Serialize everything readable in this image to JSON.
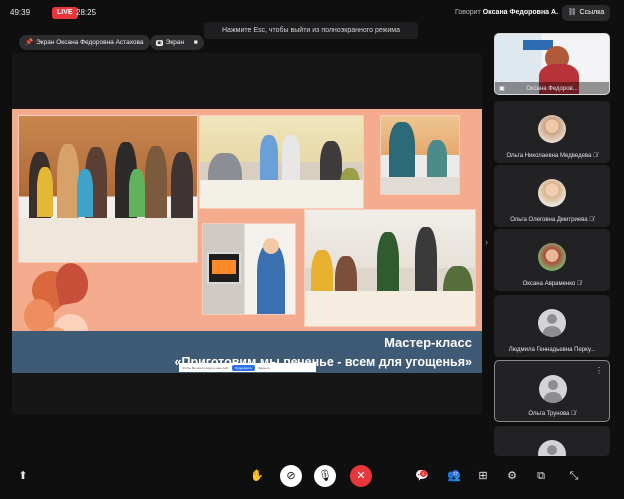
{
  "topbar": {
    "time": "49:39",
    "live_label": "LIVE",
    "elapsed": "28:25",
    "speaking_prefix": "Говорит",
    "speaking_name": "Оксана Федоровна А.",
    "link_label": "Ссылка"
  },
  "esc_hint": "Нажмите Esc, чтобы выйти из полноэкранного режима",
  "screen_share": {
    "presenter_pill": "Экран Оксана Федоровна Астахова",
    "screen_pill": "Экран"
  },
  "slide": {
    "title": "Мастер-класс",
    "subtitle": "«Приготовим мы печенье - всем для угощенья»"
  },
  "toast": {
    "text": "Чтобы Вы могли видеть наш сайт",
    "button_primary": "Продолжить",
    "button_secondary": "Закрыть"
  },
  "participants": [
    {
      "name": "Оксана Федоров...",
      "type": "video"
    },
    {
      "name": "Ольга Николаевна Медведева",
      "type": "photo",
      "mic": "off"
    },
    {
      "name": "Ольга Олеговна Дмитриева",
      "type": "photo",
      "mic": "off"
    },
    {
      "name": "Оксана Авраменко",
      "type": "photo",
      "mic": "off"
    },
    {
      "name": "Людмила Геннадьевна Перку...",
      "type": "placeholder"
    },
    {
      "name": "Ольга Трунова",
      "type": "placeholder",
      "mic": "off"
    },
    {
      "name": "",
      "type": "placeholder"
    }
  ],
  "controls": {
    "chat_badge": "1",
    "participants_badge": "17"
  },
  "colors": {
    "accent_live": "#e8363b",
    "slide_bg": "#f5ab8d",
    "ribbon": "#3f5a74",
    "toast_button": "#2f6fe6"
  }
}
